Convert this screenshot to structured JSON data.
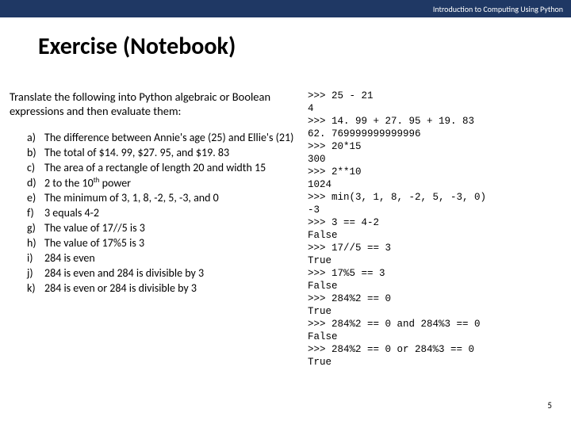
{
  "header": {
    "course": "Introduction to Computing Using Python"
  },
  "title": "Exercise (Notebook)",
  "intro": "Translate the following into Python algebraic or Boolean expressions and then evaluate them:",
  "items": [
    {
      "bullet": "a)",
      "text": "The difference between Annie's age (25) and Ellie's (21)"
    },
    {
      "bullet": "b)",
      "text": "The total of $14. 99, $27. 95, and $19. 83"
    },
    {
      "bullet": "c)",
      "text": "The area of a rectangle of length 20 and width 15"
    },
    {
      "bullet": "d)",
      "text": "2 to the 10",
      "sup": "th",
      "after": " power"
    },
    {
      "bullet": "e)",
      "text": "The minimum of 3, 1, 8, -2, 5, -3, and 0"
    },
    {
      "bullet": "f)",
      "text": "3 equals 4-2"
    },
    {
      "bullet": "g)",
      "text": "The value of 17//5 is 3"
    },
    {
      "bullet": "h)",
      "text": "The value of 17%5 is 3"
    },
    {
      "bullet": "i)",
      "text": "284 is even"
    },
    {
      "bullet": "j)",
      "text": "284 is even and 284 is divisible by 3"
    },
    {
      "bullet": "k)",
      "text": "284 is even or 284 is divisible by 3"
    }
  ],
  "code_lines": [
    ">>> 25 - 21",
    "4",
    ">>> 14. 99 + 27. 95 + 19. 83",
    "62. 769999999999996",
    ">>> 20*15",
    "300",
    ">>> 2**10",
    "1024",
    ">>> min(3, 1, 8, -2, 5, -3, 0)",
    "-3",
    ">>> 3 == 4-2",
    "False",
    ">>> 17//5 == 3",
    "True",
    ">>> 17%5 == 3",
    "False",
    ">>> 284%2 == 0",
    "True",
    ">>> 284%2 == 0 and 284%3 == 0",
    "False",
    ">>> 284%2 == 0 or 284%3 == 0",
    "True"
  ],
  "page_number": "5"
}
